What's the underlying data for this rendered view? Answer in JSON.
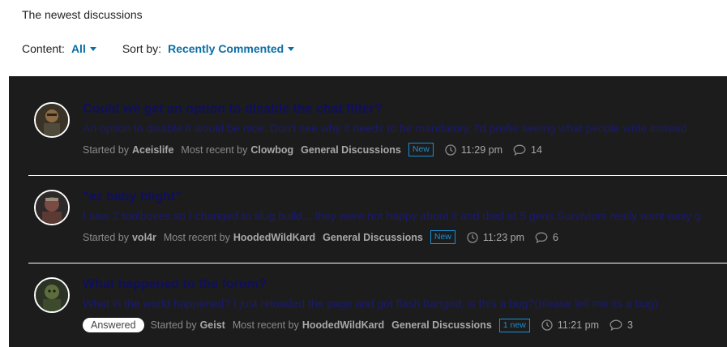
{
  "page": {
    "heading": "The newest discussions"
  },
  "filters": {
    "content_label": "Content:",
    "content_value": "All",
    "sort_label": "Sort by:",
    "sort_value": "Recently Commented"
  },
  "labels": {
    "started_by": "Started by",
    "most_recent_by": "Most recent by"
  },
  "discussions": [
    {
      "title": "Could we get an option to disable the chat filter?",
      "excerpt": "An option to disable it would be nice. Don't see why it needs to be mandatory. I'd prefer seeing what people write instead",
      "status_badge": "",
      "started_by": "Aceislife",
      "most_recent_by": "Clowbog",
      "category": "General Discussions",
      "new_badge": "New",
      "time": "11:29 pm",
      "comments": "14"
    },
    {
      "title": "\"ez baby blight\"",
      "excerpt": "I saw 2 toolboxes so I changed to slug build... they were not happy about it and died at 5 gens Surviviors really want easy g",
      "status_badge": "",
      "started_by": "vol4r",
      "most_recent_by": "HoodedWildKard",
      "category": "General Discussions",
      "new_badge": "New",
      "time": "11:23 pm",
      "comments": "6"
    },
    {
      "title": "What happened to the forum?",
      "excerpt": "What in the world happened? I just reloaded the page and got flash banged, is this a bug?(please tell me its a bug)",
      "status_badge": "Answered",
      "started_by": "Geist",
      "most_recent_by": "HoodedWildKard",
      "category": "General Discussions",
      "new_badge": "1 new",
      "time": "11:21 pm",
      "comments": "3"
    }
  ],
  "colors": {
    "link_blue": "#0a6ea6",
    "panel_bg": "#1c1c1d",
    "title_navy": "#0f0f5e",
    "badge_blue": "#1a8fd1"
  }
}
